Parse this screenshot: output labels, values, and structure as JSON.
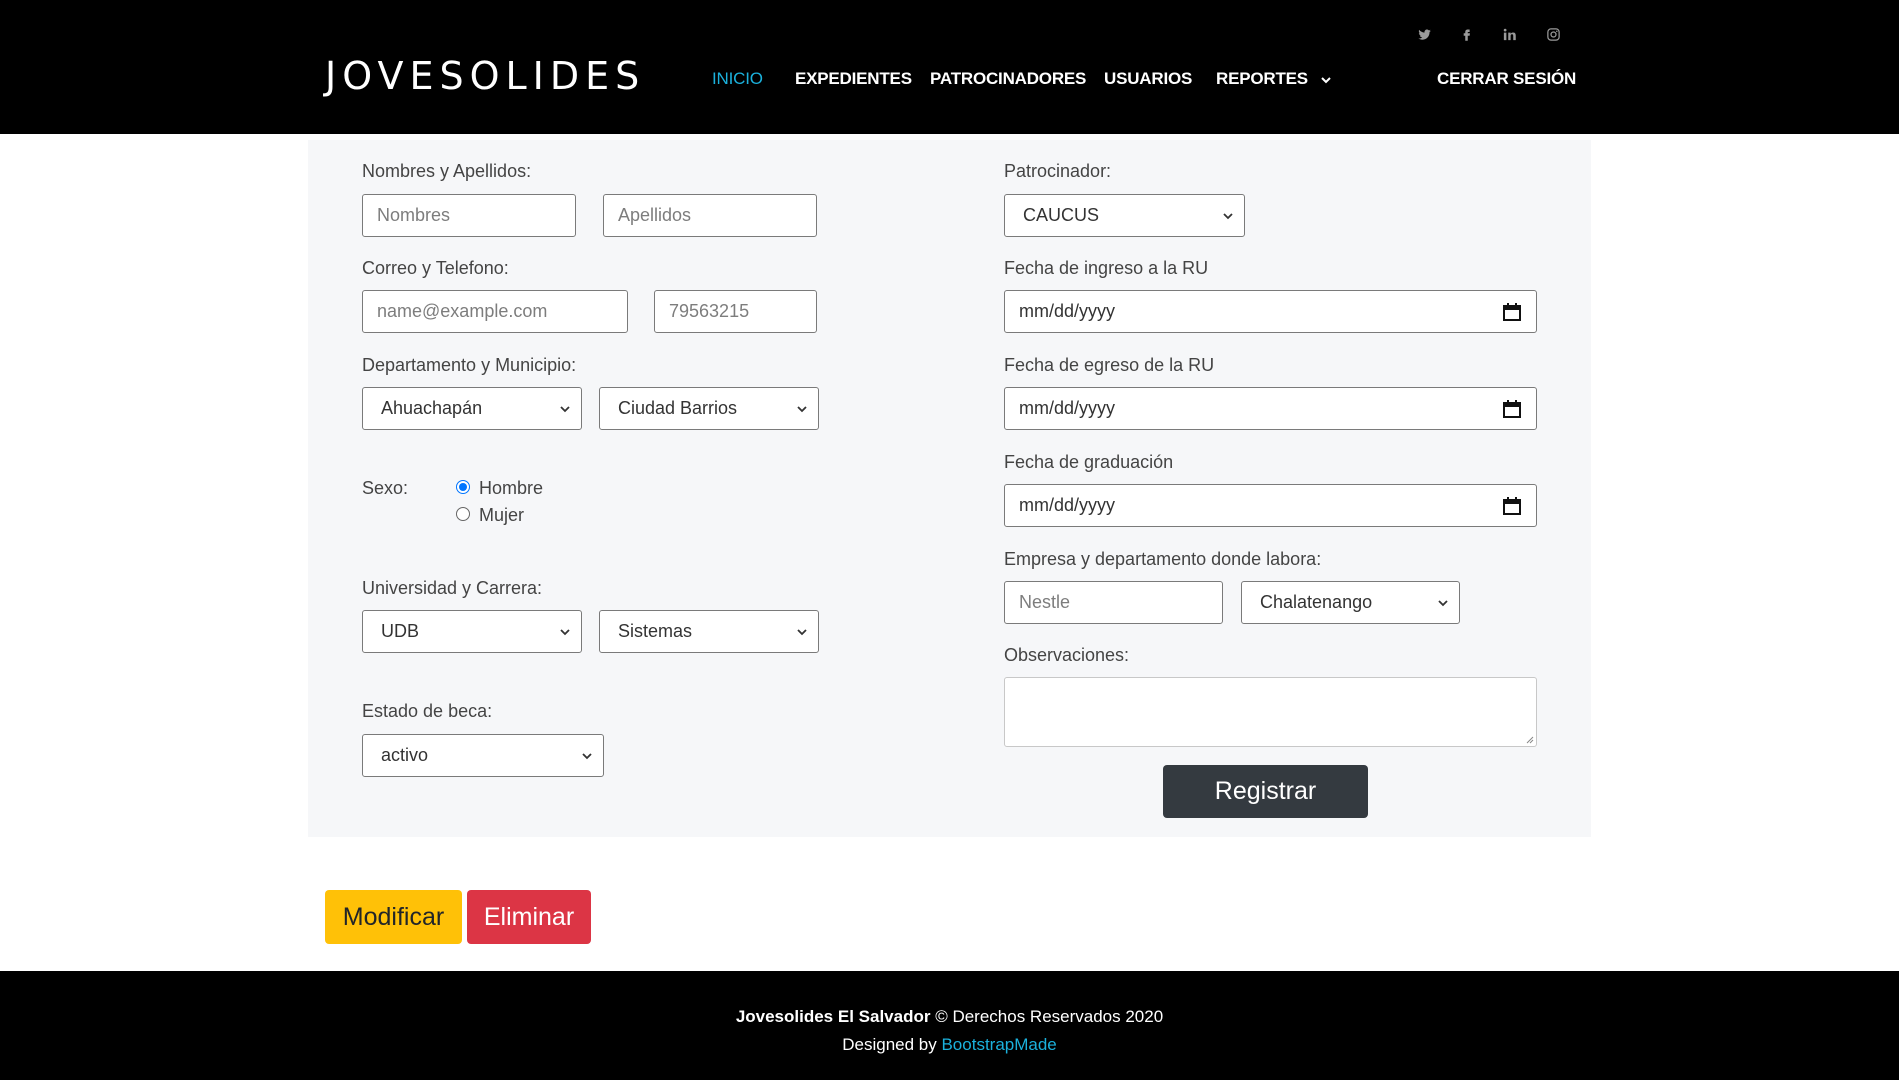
{
  "header": {
    "brand": "JOVESOLIDES",
    "social": [
      "twitter-icon",
      "facebook-icon",
      "linkedin-icon",
      "instagram-icon"
    ],
    "nav": {
      "inicio": "INICIO",
      "expedientes": "EXPEDIENTES",
      "patrocinadores": "PATROCINADORES",
      "usuarios": "USUARIOS",
      "reportes": "REPORTES",
      "logout": "CERRAR SESIÓN"
    }
  },
  "form": {
    "nombres_label": "Nombres y Apellidos:",
    "nombres_placeholder": "Nombres",
    "apellidos_placeholder": "Apellidos",
    "correo_label": "Correo y Telefono:",
    "correo_placeholder": "name@example.com",
    "telefono_placeholder": "79563215",
    "depto_label": "Departamento y Municipio:",
    "departamento_value": "Ahuachapán",
    "municipio_value": "Ciudad Barrios",
    "sexo_label": "Sexo:",
    "sexo_options": [
      "Hombre",
      "Mujer"
    ],
    "sexo_selected": "Hombre",
    "universidad_label": "Universidad y Carrera:",
    "universidad_value": "UDB",
    "carrera_value": "Sistemas",
    "estado_label": "Estado de beca:",
    "estado_value": "activo",
    "patrocinador_label": "Patrocinador:",
    "patrocinador_value": "CAUCUS",
    "ingreso_label": "Fecha de ingreso a la RU",
    "egreso_label": "Fecha de egreso de la RU",
    "graduacion_label": "Fecha de graduación",
    "date_placeholder": "mm/dd/yyyy",
    "empresa_label": "Empresa y departamento donde labora:",
    "empresa_placeholder": "Nestle",
    "empresa_depto_value": "Chalatenango",
    "observaciones_label": "Observaciones:",
    "observaciones_value": "",
    "submit": "Registrar"
  },
  "actions": {
    "modificar": "Modificar",
    "eliminar": "Eliminar"
  },
  "footer": {
    "brand": "Jovesolides El Salvador",
    "rights": " © Derechos Reservados 2020",
    "designed_prefix": "Designed by ",
    "designed_link": "BootstrapMade"
  },
  "colors": {
    "header_bg": "#000000",
    "nav_active": "#1bb1dc",
    "panel_bg": "#f6f7f9",
    "btn_dark": "#343a40",
    "btn_warning": "#ffc107",
    "btn_danger": "#dc3545",
    "radio_checked": "#0075ff"
  }
}
